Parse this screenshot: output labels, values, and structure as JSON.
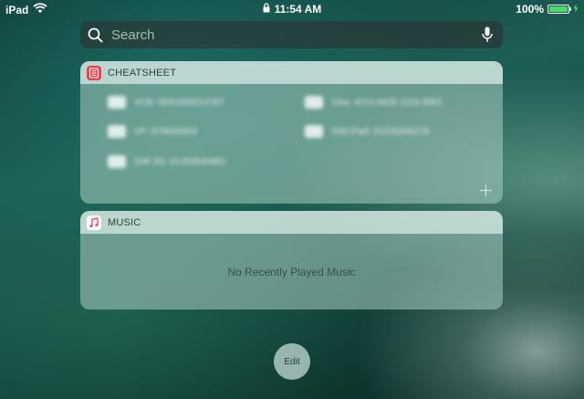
{
  "status_bar": {
    "device": "iPad",
    "time": "11:54 AM",
    "battery_percent": "100%",
    "battery_level": 1.0
  },
  "search": {
    "placeholder": "Search"
  },
  "widgets": {
    "cheatsheet": {
      "title": "CHEATSHEET",
      "items": [
        {
          "text": "VCB: 0541000214787"
        },
        {
          "text": "Visa: 4214 8426 1215 8961"
        },
        {
          "text": "VP: 879645903"
        },
        {
          "text": "SIM iPad: 01233284278"
        },
        {
          "text": "SIM 3G: 01259640881"
        }
      ]
    },
    "music": {
      "title": "MUSIC",
      "empty_message": "No Recently Played Music"
    }
  },
  "edit_label": "Edit",
  "colors": {
    "cheatsheet_icon": "#e8434d",
    "music_icon_note": "#ef3a5d",
    "battery_fill": "#4cd964"
  }
}
